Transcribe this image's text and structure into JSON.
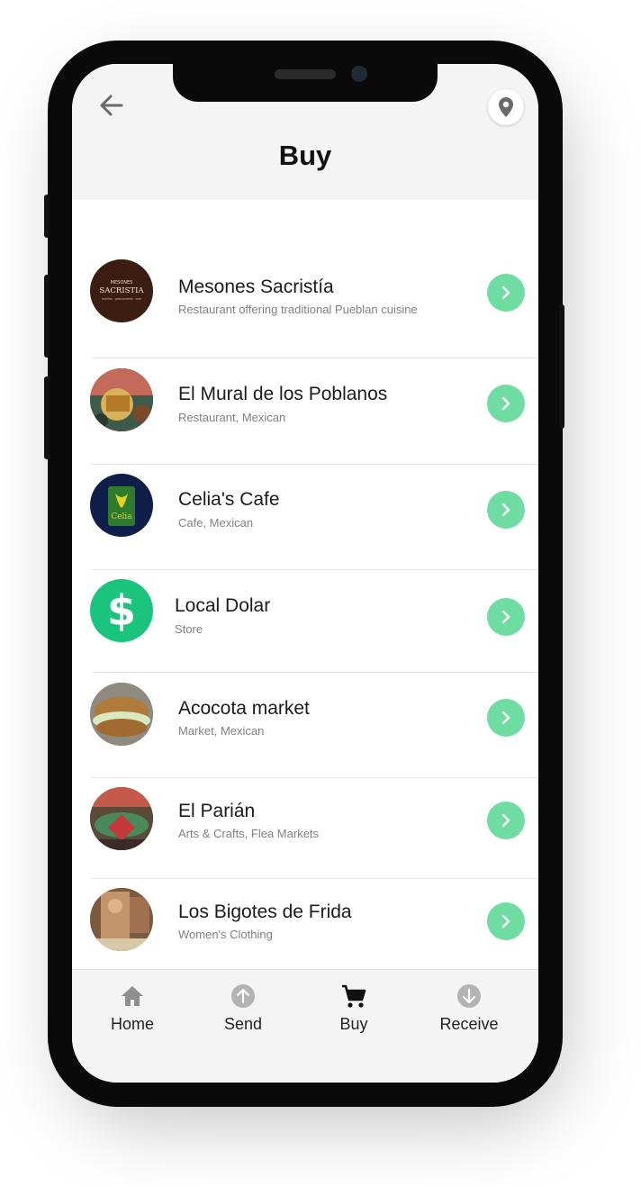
{
  "header": {
    "title": "Buy"
  },
  "icons": {
    "back": "arrow-left-icon",
    "location": "map-pin-icon"
  },
  "colors": {
    "accent": "#6fdca1",
    "dollar_green": "#1bc47d",
    "header_bg": "#f4f4f4"
  },
  "merchants": [
    {
      "name": "Mesones Sacristía",
      "subtitle": "Restaurant offering traditional Pueblan cuisine",
      "logo_text_top": "MESONES",
      "logo_text_main": "SACRISTIA",
      "logo_text_bottom": "hoteles · gastronomía · arte"
    },
    {
      "name": "El Mural de los Poblanos",
      "subtitle": "Restaurant, Mexican"
    },
    {
      "name": "Celia's Cafe",
      "subtitle": "Cafe, Mexican",
      "logo_text": "Celia"
    },
    {
      "name": "Local Dolar",
      "subtitle": "Store",
      "logo_text": "$"
    },
    {
      "name": "Acocota market",
      "subtitle": "Market, Mexican"
    },
    {
      "name": "El Parián",
      "subtitle": "Arts & Crafts, Flea Markets"
    },
    {
      "name": "Los Bigotes de Frida",
      "subtitle": "Women's Clothing"
    }
  ],
  "tabs": [
    {
      "label": "Home",
      "icon": "home-icon"
    },
    {
      "label": "Send",
      "icon": "arrow-up-circle-icon"
    },
    {
      "label": "Buy",
      "icon": "cart-icon",
      "active": true
    },
    {
      "label": "Receive",
      "icon": "arrow-down-circle-icon"
    }
  ]
}
